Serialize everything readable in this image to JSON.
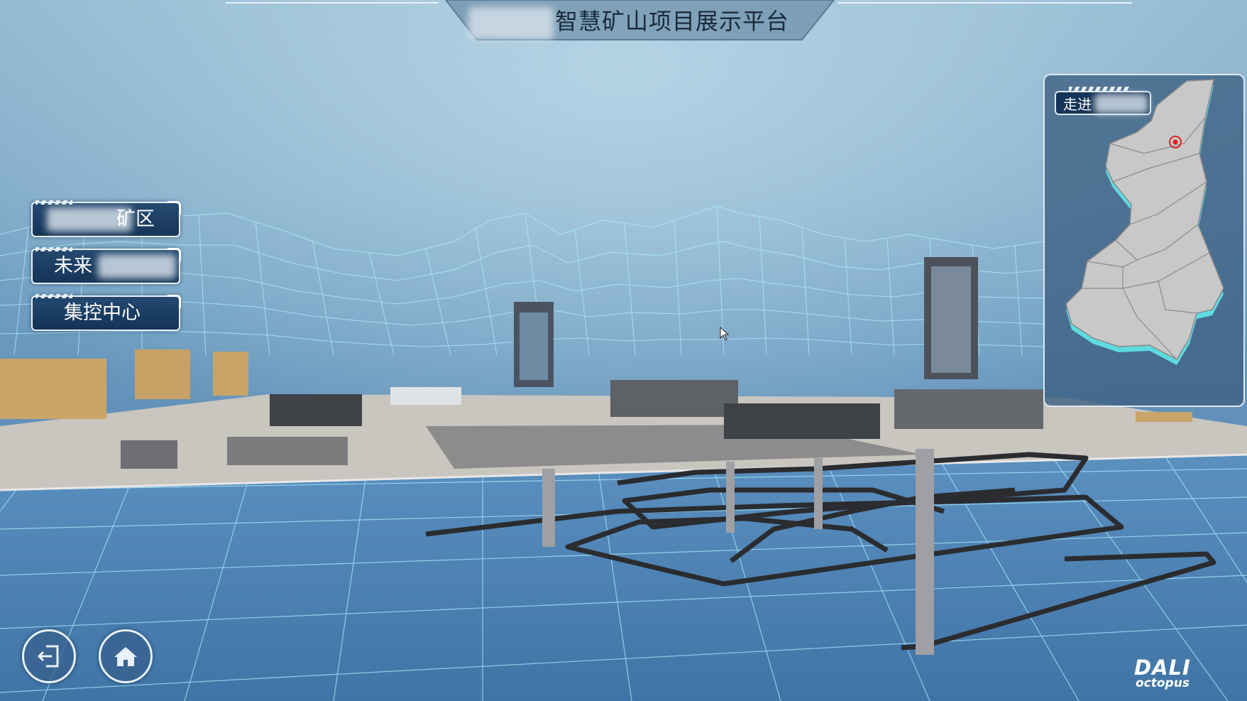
{
  "header": {
    "title": "智慧矿山项目展示平台"
  },
  "menu": {
    "items": [
      {
        "label": "矿区"
      },
      {
        "label": "未来"
      },
      {
        "label": "集控中心"
      }
    ]
  },
  "minimap": {
    "header_label": "走进",
    "marker_color": "#e02020"
  },
  "controls": {
    "back_icon": "exit-icon",
    "home_icon": "home-icon"
  },
  "branding": {
    "logo_line1": "DALI",
    "logo_line2": "octopus"
  },
  "colors": {
    "sky": "#8fb6cf",
    "grid": "#aef0ff",
    "button_bg": "#143a62",
    "map_fill": "#c8c8c8",
    "map_edge": "#5fe8e8"
  }
}
